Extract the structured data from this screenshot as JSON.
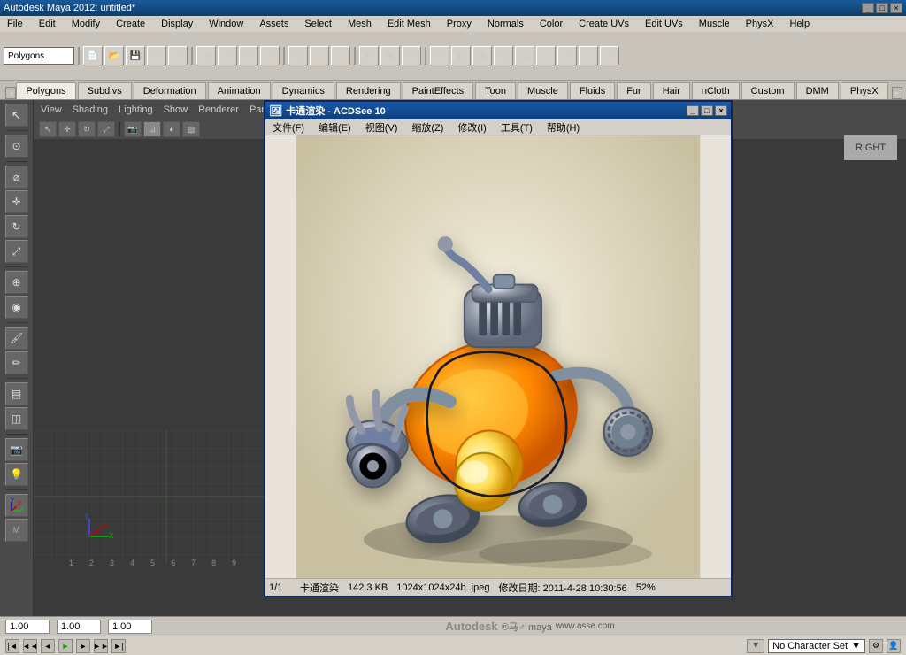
{
  "titlebar": {
    "title": "Autodesk Maya 2012: untitled*",
    "buttons": [
      "_",
      "□",
      "×"
    ]
  },
  "menubar": {
    "items": [
      "File",
      "Edit",
      "Modify",
      "Create",
      "Display",
      "Window",
      "Assets",
      "Select",
      "Mesh",
      "Edit Mesh",
      "Proxy",
      "Normals",
      "Color",
      "Create UVs",
      "Edit UVs",
      "Muscle",
      "PhysX",
      "Help"
    ]
  },
  "tabs": {
    "items": [
      "Polygons",
      "Subdivs",
      "Deformation",
      "Animation",
      "Dynamics",
      "Rendering",
      "PaintEffects",
      "Toon",
      "Muscle",
      "Fluids",
      "Fur",
      "Hair",
      "nCloth",
      "Custom",
      "DMM",
      "PhysX"
    ]
  },
  "acdsee": {
    "title": "卡通渲染 - ACDSee 10",
    "menu_items": [
      "文件(F)",
      "编辑(E)",
      "视图(V)",
      "缩放(Z)",
      "修改(I)",
      "工具(T)",
      "帮助(H)"
    ],
    "statusbar": {
      "page": "1/1",
      "name": "卡通渲染",
      "size": "142.3 KB",
      "dimensions": "1024x1024x24b .jpeg",
      "modified": "修改日期: 2011-4-28 10:30:56",
      "zoom": "52%"
    }
  },
  "viewport": {
    "menu_items": [
      "View",
      "Shading",
      "Lighting",
      "Show",
      "Renderer",
      "Pan"
    ],
    "right_label": "RIGHT",
    "ruler_marks": [
      "1",
      "2",
      "3",
      "4",
      "5",
      "6",
      "7",
      "8",
      "9"
    ]
  },
  "statusbar": {
    "coord1": "1.00",
    "coord2": "1.00",
    "coord3": "1.00"
  },
  "bottombar": {
    "char_set": "No Character Set",
    "nav_buttons": [
      "|◄",
      "◄",
      "◄",
      "►",
      "►|",
      "►►"
    ]
  },
  "toolbar": {
    "dropdown": "Polygons"
  }
}
